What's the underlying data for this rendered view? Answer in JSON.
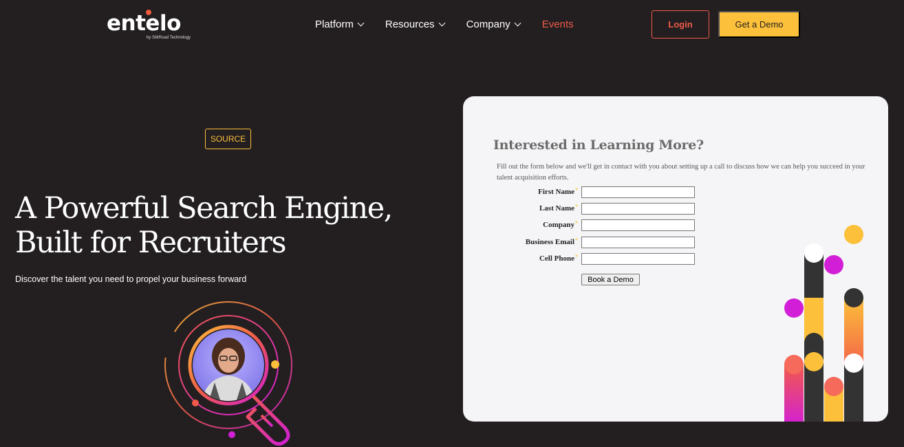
{
  "brand": {
    "logo_text": "entelo",
    "logo_sub": "by SilkRoad Technology"
  },
  "nav": {
    "items": [
      {
        "label": "Platform",
        "has_dropdown": true
      },
      {
        "label": "Resources",
        "has_dropdown": true
      },
      {
        "label": "Company",
        "has_dropdown": true
      },
      {
        "label": "Events",
        "has_dropdown": false
      }
    ],
    "login_label": "Login",
    "demo_label": "Get a Demo"
  },
  "hero": {
    "badge": "SOURCE",
    "title": "A Powerful Search Engine, Built for Recruiters",
    "subtitle": "Discover the talent you need to propel your business forward"
  },
  "form": {
    "title": "Interested in Learning More?",
    "intro": "Fill out the form below and we'll get in contact with you about setting up a call to discuss how we can help you succeed in your talent acquisition efforts.",
    "fields": [
      {
        "label": "First Name",
        "value": ""
      },
      {
        "label": "Last Name",
        "value": ""
      },
      {
        "label": "Company",
        "value": ""
      },
      {
        "label": "Business Email",
        "value": ""
      },
      {
        "label": "Cell Phone",
        "value": ""
      }
    ],
    "required_mark": "*",
    "submit_label": "Book a Demo"
  },
  "colors": {
    "background": "#231f20",
    "accent_red": "#f15a4a",
    "accent_yellow": "#fcc03a",
    "accent_magenta": "#d21fd7",
    "card": "#f5f5f7"
  },
  "icons": [
    "chevron-down-icon",
    "magnifier-illustration",
    "decorative-bars-illustration"
  ]
}
